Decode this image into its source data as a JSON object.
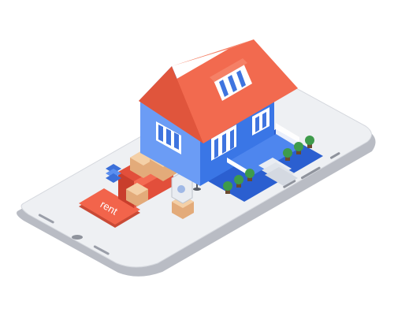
{
  "rent_button": {
    "label": "rent"
  },
  "colors": {
    "roof": "#f26a4f",
    "roof_dark": "#e0553c",
    "wall_light": "#5b8ff0",
    "wall_dark": "#2f6bde",
    "phone_body": "#eef0f3",
    "phone_edge": "#b9bcc4",
    "rent_button": "#f2644b",
    "box": "#e9b98a",
    "sofa": "#f2644b",
    "plant": "#3e9b4b"
  },
  "icons": [
    "phone-speaker-icon",
    "phone-home-button-icon",
    "house-illustration",
    "moving-boxes",
    "sofa",
    "washing-machine",
    "floor-lamp",
    "potted-plants"
  ]
}
